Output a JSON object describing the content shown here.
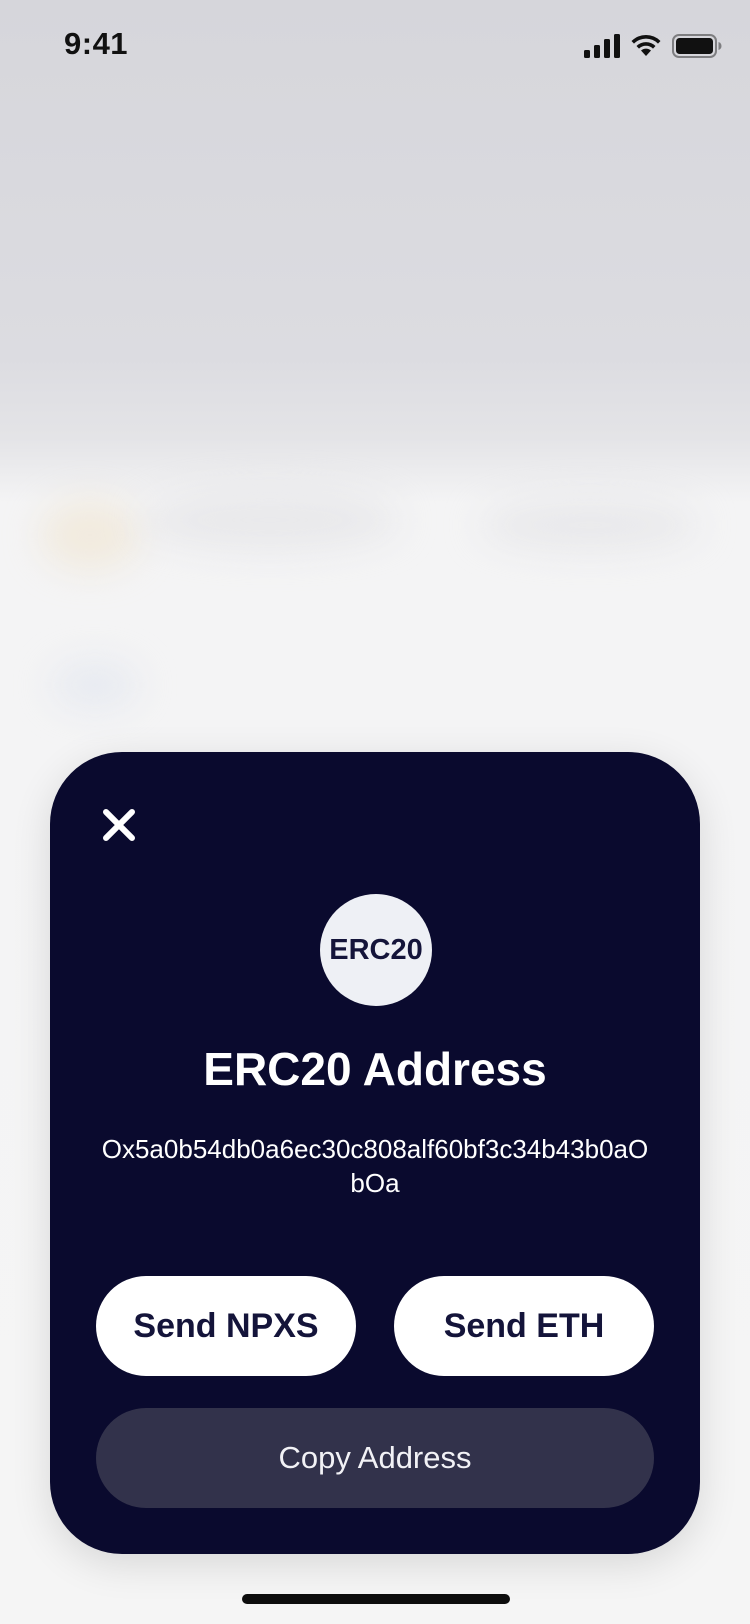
{
  "status_bar": {
    "time": "9:41",
    "icons": [
      "cellular-signal-icon",
      "wifi-icon",
      "battery-icon"
    ]
  },
  "modal": {
    "close_icon": "close-icon",
    "token_badge": "ERC20",
    "title": "ERC20 Address",
    "address": "Ox5a0b54db0a6ec30c808alf60bf3c34b43b0aObOa",
    "buttons": {
      "send_npxs": "Send NPXS",
      "send_eth": "Send ETH",
      "copy_address": "Copy Address"
    }
  },
  "colors": {
    "card_background": "#0a0a2e",
    "button_white": "#ffffff",
    "button_dark": "#32324b",
    "badge_background": "#eef0f5",
    "text_dark": "#14143a"
  }
}
